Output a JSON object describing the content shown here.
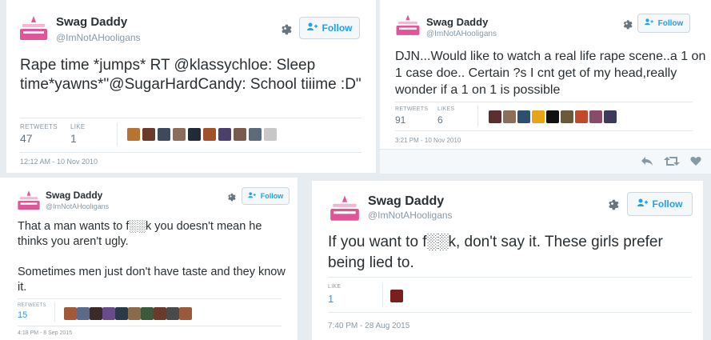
{
  "tweets": [
    {
      "name": "Swag Daddy",
      "handle": "@ImNotAHooligans",
      "follow_label": "Follow",
      "text": "Rape time *jumps* RT @klassychloe: Sleep time*yawns*\"@SugarHardCandy: School tiiime :D\"",
      "retweets_label": "RETWEETS",
      "retweets": "47",
      "likes_label": "LIKE",
      "likes": "1",
      "timestamp": "12:12 AM - 10 Nov 2010"
    },
    {
      "name": "Swag Daddy",
      "handle": "@ImNotAHooligans",
      "follow_label": "Follow",
      "text": "DJN...Would like to watch a real life rape scene..a 1 on 1 case doe.. Certain ?s I cnt get of my head,really wonder if a 1 on 1 is possible",
      "retweets_label": "RETWEETS",
      "retweets": "91",
      "likes_label": "LIKES",
      "likes": "6",
      "timestamp": "3:21 PM - 10 Nov 2010"
    },
    {
      "name": "Swag Daddy",
      "handle": "@ImNotAHooligans",
      "follow_label": "Follow",
      "text": "That a man wants to f░░k you doesn't mean he thinks you aren't ugly.\n\nSometimes men just don't have taste and they know it.",
      "retweets_label": "RETWEETS",
      "retweets": "15",
      "timestamp": "4:18 PM - 8 Sep 2015"
    },
    {
      "name": "Swag Daddy",
      "handle": "@ImNotAHooligans",
      "follow_label": "Follow",
      "text": "If you want to f░░k, don't say it. These girls prefer being lied to.",
      "likes_label": "LIKE",
      "likes": "1",
      "timestamp": "7:40 PM - 28 Aug 2015"
    }
  ],
  "likers": {
    "t1": [
      "#b87333",
      "#6b3a2a",
      "#3d4a5c",
      "#8a6d5a",
      "#1f2a3a",
      "#a0522d",
      "#4b3f6b",
      "#7a5c4f",
      "#5c6b7a",
      "#c7c7c7"
    ],
    "t2": [
      "#5a2f2f",
      "#8c6f5a",
      "#2f4f6f",
      "#e8a317",
      "#111111",
      "#6b5a3a",
      "#c04a2a",
      "#8a4a6a",
      "#3a3a5a"
    ],
    "t3": [
      "#a05a3a",
      "#5a6a8a",
      "#3a2a2a",
      "#6a4a8a",
      "#2a3a4a",
      "#8a6a4a",
      "#3a5a3a",
      "#6a3a2a",
      "#4a4a4a",
      "#9a5a3a"
    ],
    "t4": [
      "#7a1f1f"
    ]
  },
  "colors": {
    "accent": "#1da1f2",
    "text": "#292f33",
    "muted": "#8899a6",
    "logo_pink": "#e0559a"
  },
  "icons": [
    "profile-logo-icon",
    "gear-icon",
    "follow-person-icon",
    "reply-icon",
    "retweet-icon",
    "heart-icon"
  ]
}
